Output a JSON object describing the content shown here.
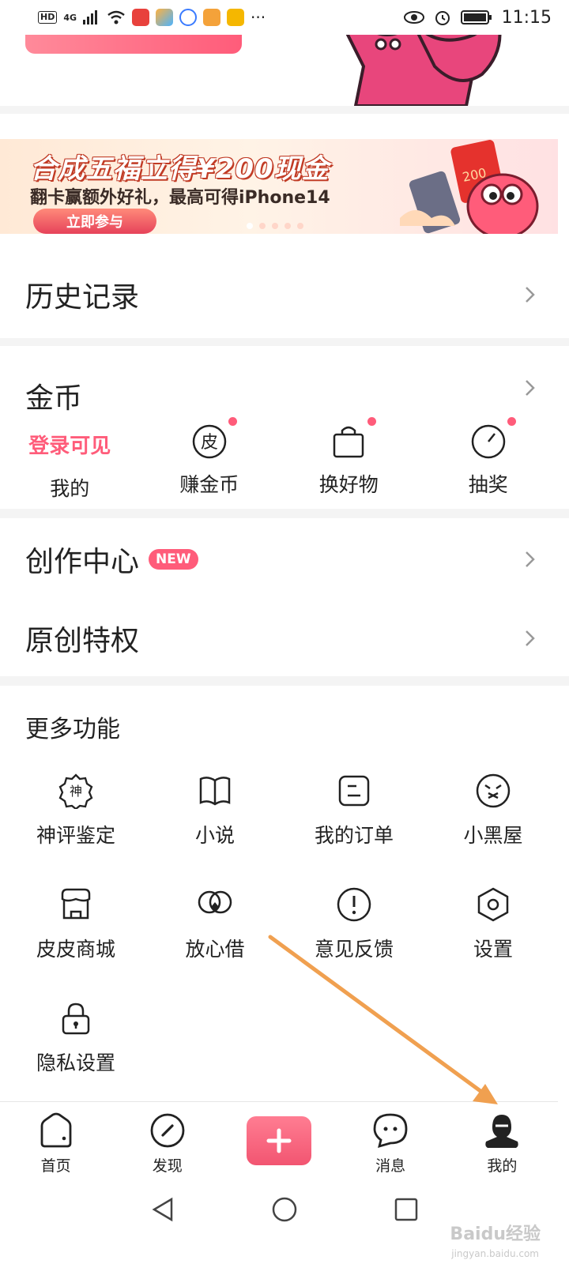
{
  "status_bar": {
    "network_tag": "HD",
    "signal_tag": "4G",
    "time": "11:15"
  },
  "banner": {
    "title": "合成五福立得¥200现金",
    "subtitle": "翻卡赢额外好礼，最高可得iPhone14",
    "button": "立即参与",
    "red_packet_value": "200"
  },
  "rows": {
    "history": "历史记录",
    "coins": "金币",
    "creator_center": "创作中心",
    "creator_badge": "NEW",
    "original_privilege": "原创特权"
  },
  "coins_panel": {
    "login_visible": "登录可见",
    "mine": "我的",
    "earn_coins": "赚金币",
    "exchange_goods": "换好物",
    "lottery": "抽奖",
    "earn_icon_glyph": "皮"
  },
  "more_functions": {
    "title": "更多功能",
    "items": [
      {
        "label": "神评鉴定",
        "icon": "shen-badge-icon",
        "glyph": "神"
      },
      {
        "label": "小说",
        "icon": "book-icon"
      },
      {
        "label": "我的订单",
        "icon": "order-icon"
      },
      {
        "label": "小黑屋",
        "icon": "sad-face-icon"
      },
      {
        "label": "皮皮商城",
        "icon": "store-icon"
      },
      {
        "label": "放心借",
        "icon": "loan-icon"
      },
      {
        "label": "意见反馈",
        "icon": "feedback-icon"
      },
      {
        "label": "设置",
        "icon": "settings-icon"
      },
      {
        "label": "隐私设置",
        "icon": "lock-icon"
      }
    ]
  },
  "bottom_nav": {
    "home": "首页",
    "discover": "发现",
    "post": "+",
    "messages": "消息",
    "mine": "我的"
  },
  "watermark": {
    "brand": "Baidu经验",
    "site": "jingyan.baidu.com"
  },
  "colors": {
    "accent": "#ff5c7a",
    "arrow": "#f0a050",
    "divider": "#f4f4f4"
  }
}
